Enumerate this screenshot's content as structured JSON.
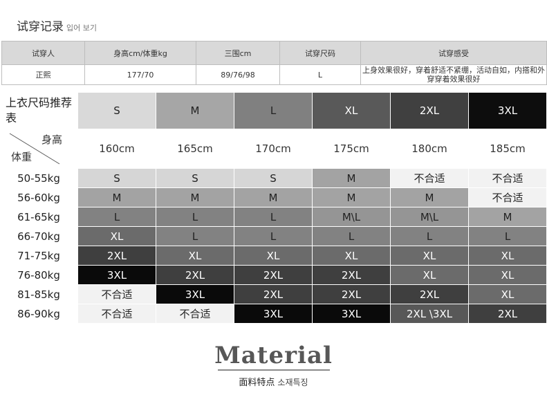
{
  "header": {
    "title": "试穿记录",
    "subtitle": "입어 보기"
  },
  "record": {
    "headers": [
      "试穿人",
      "身高cm/体重kg",
      "三围cm",
      "试穿尺码",
      "试穿感受"
    ],
    "row": [
      "正熙",
      "177/70",
      "89/76/98",
      "L",
      "上身效果很好，穿着舒适不紧绷，活动自如，内搭和外穿穿着效果很好"
    ]
  },
  "size_table": {
    "title": "上衣尺码推荐表",
    "corner_height_label": "身高",
    "corner_weight_label": "体重",
    "sizes": [
      "S",
      "M",
      "L",
      "XL",
      "2XL",
      "3XL"
    ],
    "size_colors": [
      "#d9d9d9",
      "#a6a6a6",
      "#808080",
      "#595959",
      "#404040",
      "#0d0d0d"
    ],
    "heights": [
      "160cm",
      "165cm",
      "170cm",
      "175cm",
      "180cm",
      "185cm"
    ],
    "rows": [
      {
        "weight": "50-55kg",
        "cells": [
          "S",
          "S",
          "S",
          "M",
          "不合适",
          "不合适"
        ]
      },
      {
        "weight": "56-60kg",
        "cells": [
          "M",
          "M",
          "M",
          "M",
          "M",
          "不合适"
        ]
      },
      {
        "weight": "61-65kg",
        "cells": [
          "L",
          "L",
          "L",
          "M\\L",
          "M\\L",
          "M"
        ]
      },
      {
        "weight": "66-70kg",
        "cells": [
          "XL",
          "L",
          "L",
          "L",
          "L",
          "L"
        ]
      },
      {
        "weight": "71-75kg",
        "cells": [
          "2XL",
          "XL",
          "XL",
          "XL",
          "XL",
          "XL"
        ]
      },
      {
        "weight": "76-80kg",
        "cells": [
          "3XL",
          "2XL",
          "2XL",
          "2XL",
          "XL",
          "XL"
        ]
      },
      {
        "weight": "81-85kg",
        "cells": [
          "不合适",
          "3XL",
          "2XL",
          "2XL",
          "2XL",
          "XL"
        ]
      },
      {
        "weight": "86-90kg",
        "cells": [
          "不合适",
          "不合适",
          "3XL",
          "3XL",
          "2XL \\3XL",
          "2XL"
        ]
      }
    ]
  },
  "footer": {
    "title": "Material",
    "subtitle": "面料特点",
    "subtitle_kr": "소재특징"
  }
}
